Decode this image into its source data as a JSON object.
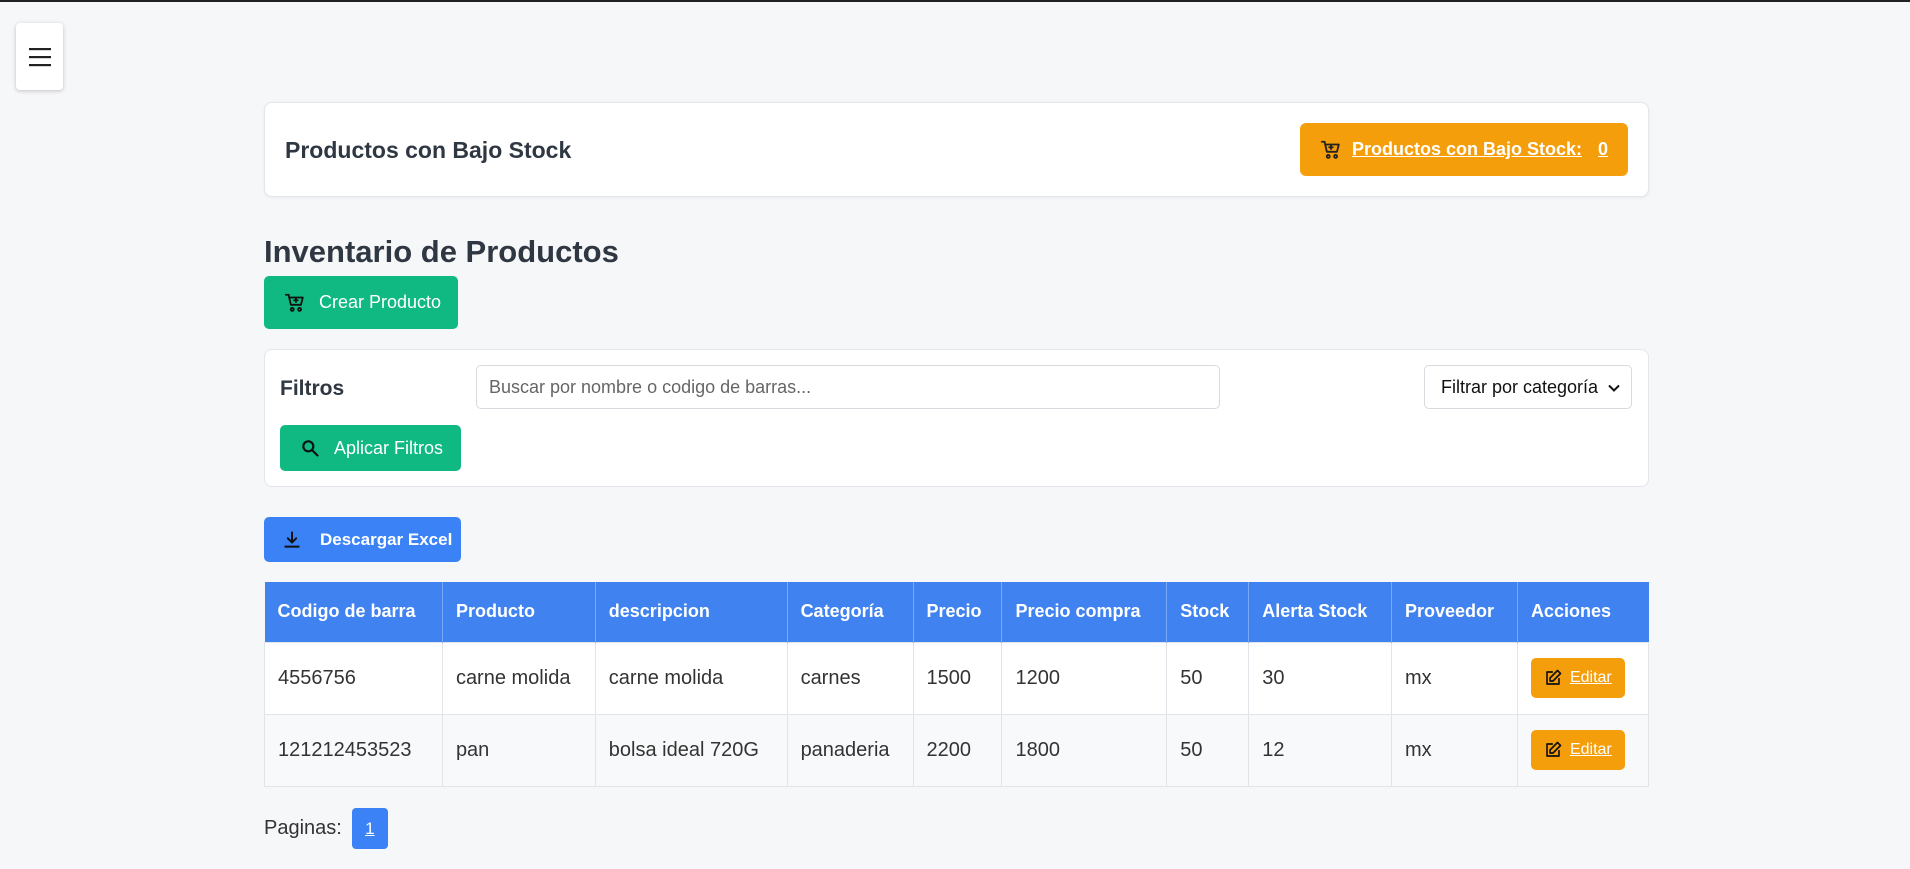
{
  "header": {
    "menu_icon": "hamburger-icon"
  },
  "low_stock": {
    "title": "Productos con Bajo Stock",
    "button_label": "Productos con Bajo Stock:",
    "count": "0",
    "icon": "cart-icon"
  },
  "inventory": {
    "title": "Inventario de Productos",
    "create_label": "Crear Producto",
    "create_icon": "cart-add-icon"
  },
  "filters": {
    "label": "Filtros",
    "search_placeholder": "Buscar por nombre o codigo de barras...",
    "search_value": "",
    "category_selected": "Filtrar por categoría",
    "apply_label": "Aplicar Filtros",
    "apply_icon": "search-icon"
  },
  "export": {
    "excel_label": "Descargar Excel",
    "icon": "download-icon"
  },
  "table": {
    "columns": [
      "Codigo de barra",
      "Producto",
      "descripcion",
      "Categoría",
      "Precio",
      "Precio compra",
      "Stock",
      "Alerta Stock",
      "Proveedor",
      "Acciones"
    ],
    "rows": [
      {
        "codigo": "4556756",
        "producto": "carne molida",
        "descripcion": "carne molida",
        "categoria": "carnes",
        "precio": "1500",
        "precio_compra": "1200",
        "stock": "50",
        "alerta": "30",
        "proveedor": "mx",
        "accion": "Editar"
      },
      {
        "codigo": "121212453523",
        "producto": "pan",
        "descripcion": "bolsa ideal 720G",
        "categoria": "panaderia",
        "precio": "2200",
        "precio_compra": "1800",
        "stock": "50",
        "alerta": "12",
        "proveedor": "mx",
        "accion": "Editar"
      }
    ]
  },
  "pagination": {
    "label": "Paginas:",
    "pages": [
      "1"
    ]
  },
  "colors": {
    "green": "#10b981",
    "blue": "#3b82f6",
    "amber": "#f59e0b",
    "header_blue": "#4083f0"
  }
}
